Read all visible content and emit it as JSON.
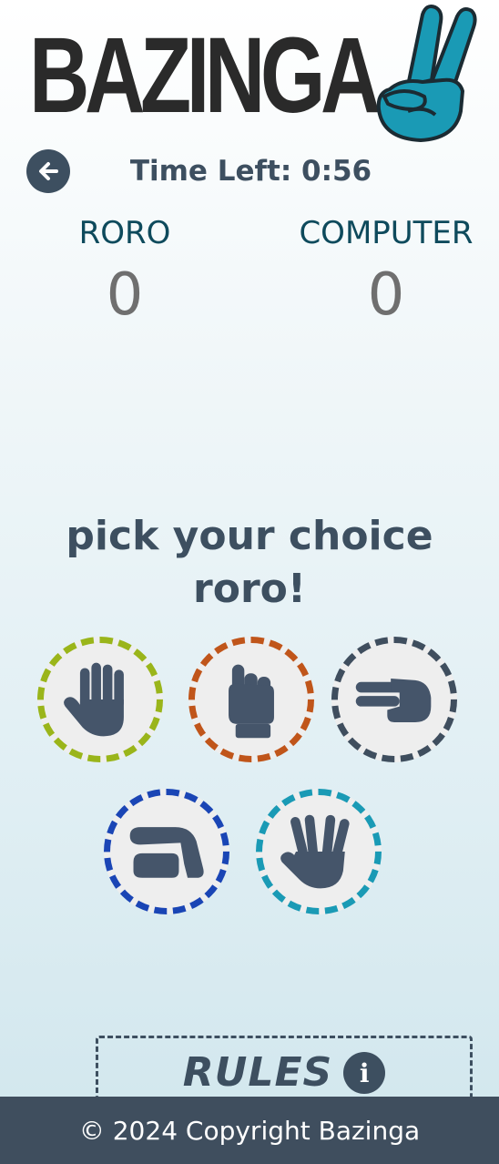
{
  "logo": {
    "text": "BAZINGA",
    "hand_icon": "victory-hand-icon",
    "hand_color": "#1a9ab5"
  },
  "header": {
    "back_icon": "arrow-left-icon",
    "timer_label": "Time Left: 0:56"
  },
  "scores": {
    "player": {
      "name": "RORO",
      "value": "0"
    },
    "computer": {
      "name": "COMPUTER",
      "value": "0"
    }
  },
  "prompt": {
    "line1": "pick your choice",
    "line2": "roro!"
  },
  "choices": [
    {
      "id": "paper",
      "icon": "paper-hand-icon",
      "color": "#9ab51a"
    },
    {
      "id": "rock",
      "icon": "rock-fist-icon",
      "color": "#c0551a"
    },
    {
      "id": "scissors",
      "icon": "scissors-hand-icon",
      "color": "#3f4e5e"
    },
    {
      "id": "lizard",
      "icon": "lizard-hand-icon",
      "color": "#1a45b5"
    },
    {
      "id": "spock",
      "icon": "spock-hand-icon",
      "color": "#1a9ab5"
    }
  ],
  "rules": {
    "label": "RULES",
    "icon": "info-icon",
    "icon_glyph": "i"
  },
  "footer": {
    "text": "© 2024 Copyright Bazinga"
  }
}
